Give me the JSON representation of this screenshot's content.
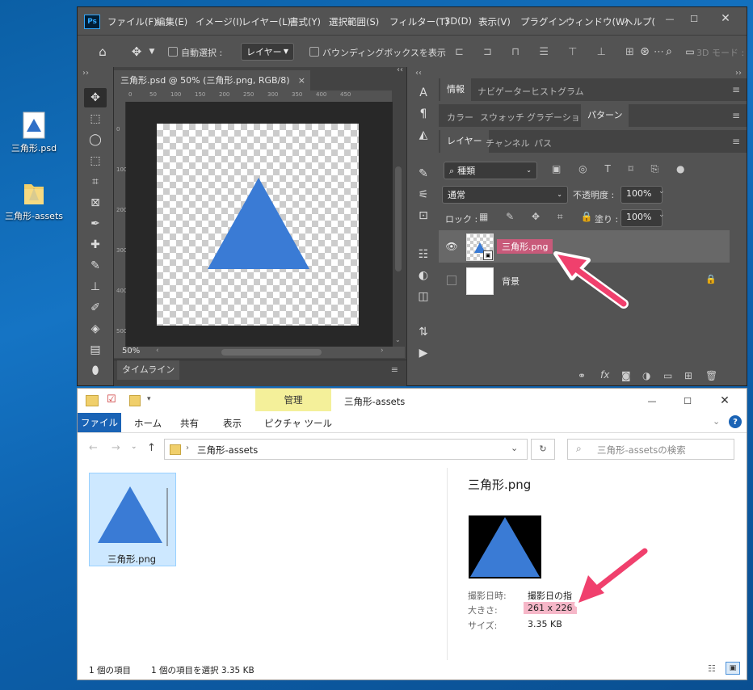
{
  "desktop": {
    "icons": [
      {
        "label": "三角形.psd"
      },
      {
        "label": "三角形-assets"
      }
    ]
  },
  "photoshop": {
    "logo": "Ps",
    "menu": [
      "ファイル(F)",
      "編集(E)",
      "イメージ(I)",
      "レイヤー(L)",
      "書式(Y)",
      "選択範囲(S)",
      "フィルター(T)",
      "3D(D)",
      "表示(V)",
      "プラグイン",
      "ウィンドウ(W)",
      "ヘルプ("
    ],
    "options": {
      "auto_select_label": "自動選択 :",
      "auto_select_target": "レイヤー",
      "bounding_box_label": "バウンディングボックスを表示",
      "mode_3d": "3D モード :"
    },
    "document": {
      "tab_title": "三角形.psd @ 50% (三角形.png, RGB/8)",
      "close": "×",
      "zoom": "50%",
      "ruler_top": [
        "0",
        "50",
        "100",
        "150",
        "200",
        "250",
        "300",
        "350",
        "400",
        "450"
      ],
      "ruler_left": [
        "0",
        "100",
        "200",
        "300",
        "400",
        "500"
      ],
      "timeline": "タイムライン"
    },
    "panels": {
      "row1_tabs": [
        "情報",
        "ナビゲーター",
        "ヒストグラム"
      ],
      "row2_tabs": [
        "カラー",
        "スウォッチ",
        "グラデーション",
        "パターン"
      ],
      "row3_tabs": [
        "レイヤー",
        "チャンネル",
        "パス"
      ],
      "kind_filter": "種類",
      "blend_mode": "通常",
      "opacity_label": "不透明度 :",
      "opacity_value": "100%",
      "lock_label": "ロック :",
      "fill_label": "塗り :",
      "fill_value": "100%",
      "layers": [
        {
          "name": "三角形.png",
          "visible": true
        },
        {
          "name": "背景",
          "visible": false
        }
      ],
      "fx": "fx"
    }
  },
  "explorer": {
    "title": "三角形-assets",
    "manage_tab": "管理",
    "picture_tools": "ピクチャ ツール",
    "ribbon_tabs": [
      "ファイル",
      "ホーム",
      "共有",
      "表示"
    ],
    "address": "三角形-assets",
    "search_placeholder": "三角形-assetsの検索",
    "file": {
      "name": "三角形.png"
    },
    "details": {
      "title": "三角形.png",
      "date_label": "撮影日時:",
      "date_value": "撮影日の指",
      "size_label": "大きさ:",
      "size_value": "261 x 226",
      "filesize_label": "サイズ:",
      "filesize_value": "3.35 KB"
    },
    "status": {
      "items": "1 個の項目",
      "selected": "1 個の項目を選択  3.35 KB"
    }
  },
  "colors": {
    "triangle": "#3a7bd5",
    "highlight": "#f6b7c8",
    "arrow": "#f0406d"
  }
}
